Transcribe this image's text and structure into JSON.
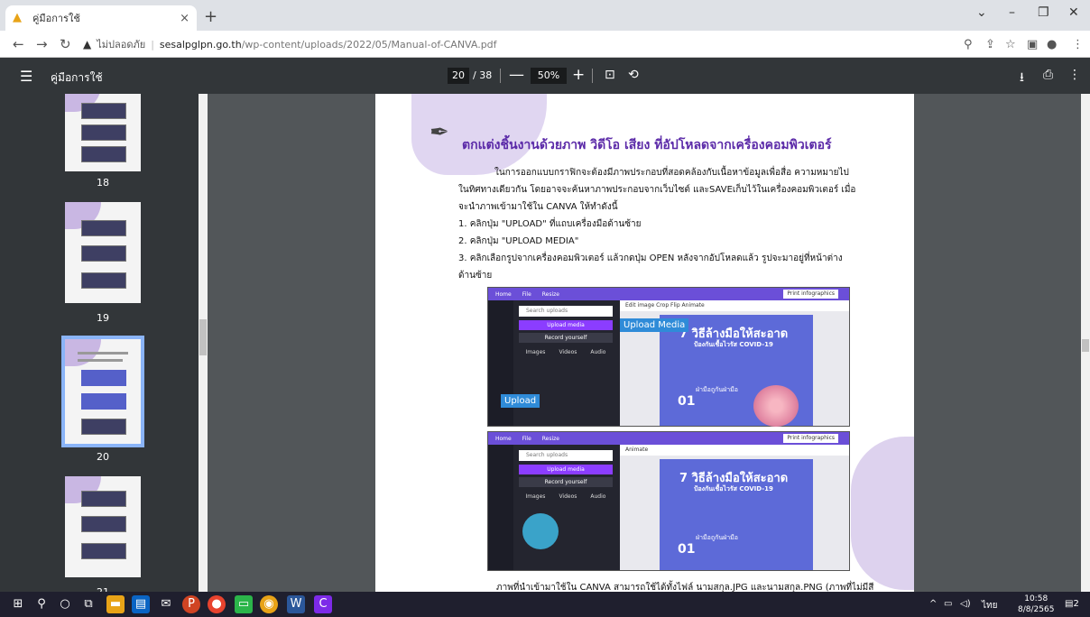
{
  "browser": {
    "tab_title": "คู่มือการใช้",
    "tab_close": "×",
    "new_tab": "+",
    "not_secure": "ไม่ปลอดภัย",
    "url_host": "sesalpglpn.go.th",
    "url_path": "/wp-content/uploads/2022/05/Manual-of-CANVA.pdf",
    "favicon_color": "#e8a317"
  },
  "pdf_toolbar": {
    "doc_title": "คู่มือการใช้",
    "current_page": "20",
    "total_pages": "/ 38",
    "zoom": "50%",
    "minus": "—",
    "plus": "+"
  },
  "thumbnails": [
    {
      "label": "18"
    },
    {
      "label": "19"
    },
    {
      "label": "20",
      "selected": true
    },
    {
      "label": "21"
    }
  ],
  "page": {
    "heading": "ตกแต่งชิ้นงานด้วยภาพ วิดีโอ เสียง ที่อัปโหลดจากเครื่องคอมพิวเตอร์",
    "para1": "ในการออกแบบกราฟิกจะต้องมีภาพประกอบที่สอดคล้องกับเนื้อหาข้อมูลเพื่อสื่อ ความหมายไป",
    "para2": "ในทิศทางเดียวกัน โดยอาจจะค้นหาภาพประกอบจากเว็บไซต์ และSAVEเก็บไว้ในเครื่องคอมพิวเตอร์ เมื่อ",
    "para3": "จะนำภาพเข้ามาใช้ใน CANVA ให้ทำดังนี้",
    "step1": "1. คลิกปุ่ม \"UPLOAD\" ที่แถบเครื่องมือด้านซ้าย",
    "step2": "2. คลิกปุ่ม \"UPLOAD MEDIA\"",
    "step3a": "3. คลิกเลือกรูปจากเครื่องคอมพิวเตอร์ แล้วกดปุ่ม OPEN หลังจากอัปโหลดแล้ว รูปจะมาอยู่ที่หน้าต่าง",
    "step3b": "ด้านซ้าย",
    "bottom": "ภาพที่นำเข้ามาใช้ใน CANVA สามารถใช้ได้ทั้งไฟล์ นามสกุล.JPG และนามสกุล.PNG (ภาพที่ไม่มีสี",
    "heading_color": "#5b2aa8"
  },
  "canva1": {
    "home": "Home",
    "file": "File",
    "resize": "Resize",
    "print": "Print infographics",
    "search": "Search uploads",
    "upload_media": "Upload media",
    "record": "Record yourself",
    "tab_images": "Images",
    "tab_videos": "Videos",
    "tab_audio": "Audio",
    "editbar": "Edit image   Crop   Flip   Animate",
    "callout_upload_media": "Upload Media",
    "callout_upload": "Upload",
    "design_title": "7 วิธีล้างมือให้สะอาด",
    "design_sub": "ป้องกันเชื้อไวรัส COVID-19",
    "num": "01",
    "hand": "ฝ่ามือถูกันฝ่ามือ"
  },
  "canva2": {
    "home": "Home",
    "file": "File",
    "resize": "Resize",
    "print": "Print infographics",
    "search": "Search uploads",
    "upload_media": "Upload media",
    "record": "Record yourself",
    "tab_images": "Images",
    "tab_videos": "Videos",
    "tab_audio": "Audio",
    "editbar": "Animate",
    "design_title": "7 วิธีล้างมือให้สะอาด",
    "design_sub": "ป้องกันเชื้อไวรัส COVID-19",
    "num": "01",
    "hand": "ฝ่ามือถูกันฝ่ามือ"
  },
  "taskbar": {
    "lang": "ไทย",
    "time": "10:58",
    "date": "8/8/2565",
    "notif": "2"
  }
}
